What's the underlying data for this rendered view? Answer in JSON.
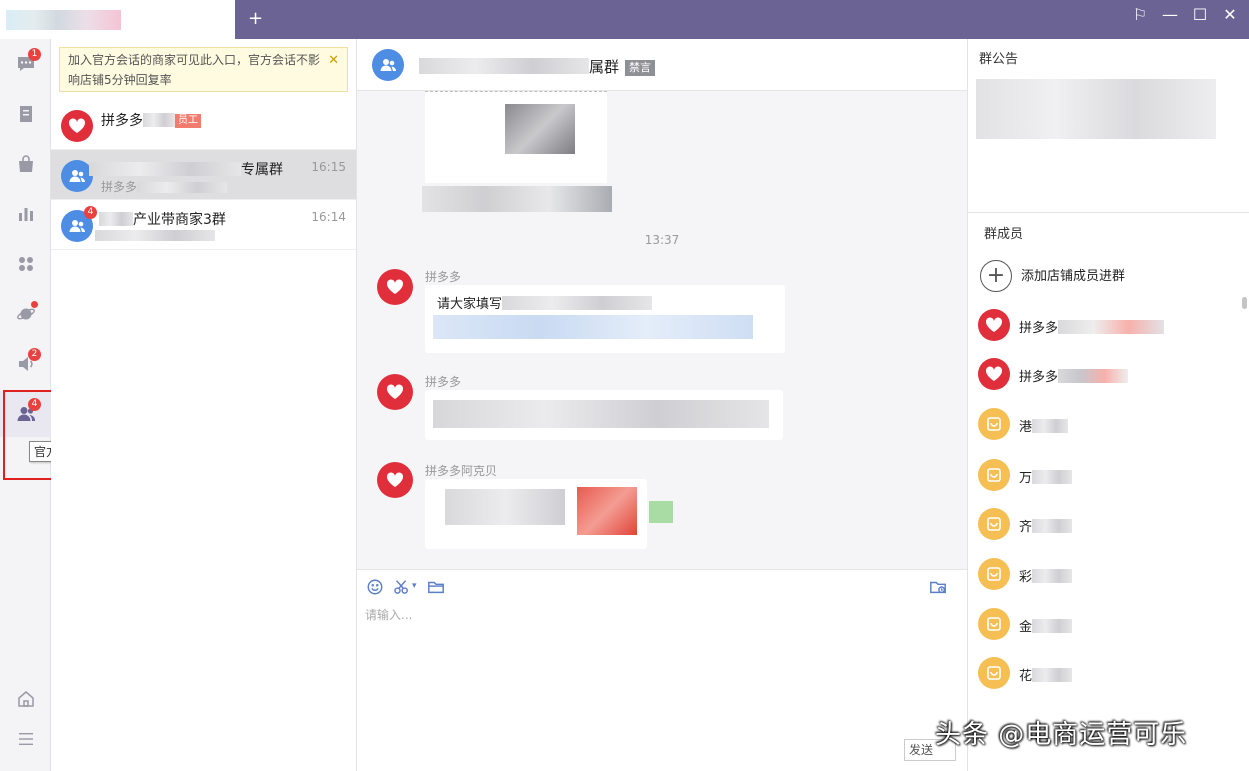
{
  "titlebar": {
    "add_tab": "+",
    "pin": "⚐",
    "minimize": "—",
    "maximize": "☐",
    "close": "✕"
  },
  "nav": {
    "badges": {
      "messages": "1",
      "broadcast": "2",
      "official": "4"
    },
    "tooltip": "官方会话"
  },
  "notice": {
    "text": "加入官方会话的商家可见此入口，官方会话不影响店铺5分钟回复率",
    "close": "✕"
  },
  "sessions": [
    {
      "name": "拼多多",
      "tag": "员工",
      "time": "",
      "badge": ""
    },
    {
      "name": "专属群",
      "sub": "拼多多",
      "time": "16:15",
      "badge": ""
    },
    {
      "name": "产业带商家3群",
      "sub": "",
      "time": "16:14",
      "badge": "4"
    }
  ],
  "chat": {
    "title": "属群",
    "mute": "禁言",
    "time_sep": "13:37",
    "msg1_sender": "拼多多",
    "msg1_text": "请大家填写",
    "msg2_sender": "拼多多",
    "msg3_sender": "拼多多阿克贝",
    "placeholder": "请输入...",
    "send": "发送"
  },
  "side": {
    "notice_title": "群公告",
    "members_title": "群成员",
    "add_member": "添加店铺成员进群",
    "members": [
      "拼多多",
      "拼多多",
      "港",
      "万",
      "齐",
      "彩",
      "金",
      "花"
    ]
  },
  "watermark": "头条 @电商运营可乐",
  "colors": {
    "titlebar": "#6b6394",
    "accent": "#4d8de4",
    "red": "#e02e3a",
    "badge": "#e8413f"
  }
}
